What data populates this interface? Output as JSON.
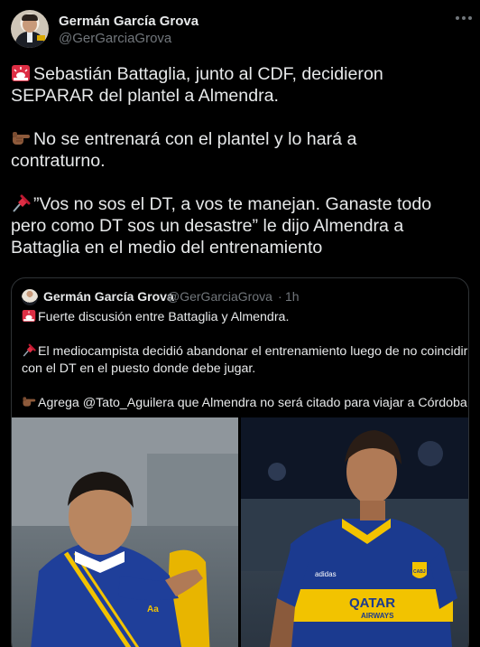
{
  "tweet": {
    "author": {
      "name": "Germán García Grova",
      "handle": "@GerGarciaGrova"
    },
    "body": {
      "line1": "Sebastián Battaglia, junto al CDF, decidieron",
      "line2": "SEPARAR del plantel a Almendra.",
      "line3": "No se entrenará con el plantel y lo hará a",
      "line4": "contraturno.",
      "line5": "”Vos no sos el DT, a vos te manejan. Ganaste todo",
      "line6": "pero como DT sos un desastre” le dijo Almendra a",
      "line7": "Battaglia en el medio del entrenamiento"
    },
    "emoji": [
      "siren-emoji",
      "pointing-hand-emoji",
      "pushpin-emoji"
    ]
  },
  "quoted_tweet": {
    "author": {
      "name": "Germán García Grova",
      "handle": "@GerGarciaGrova",
      "time": "1h",
      "separator": "·"
    },
    "body": {
      "line1": "Fuerte discusión entre Battaglia y Almendra.",
      "line2": "El mediocampista decidió abandonar el entrenamiento luego de no coincidir",
      "line3": "con el DT en el puesto donde debe jugar.",
      "line4": "Agrega @Tato_Aguilera que Almendra no será citado para viajar a Córdoba."
    },
    "media": {
      "left": {
        "jacket_logo": "Aa"
      },
      "right": {
        "sponsor_line1": "QATAR",
        "sponsor_line2": "AIRWAYS",
        "kit_brand": "adidas",
        "crest": "CABJ"
      }
    }
  },
  "colors": {
    "background": "#000000",
    "text": "#e7e9ea",
    "muted": "#71767b",
    "border": "#2f3336",
    "boca_blue": "#1b3a8f",
    "boca_gold": "#f2c300"
  }
}
